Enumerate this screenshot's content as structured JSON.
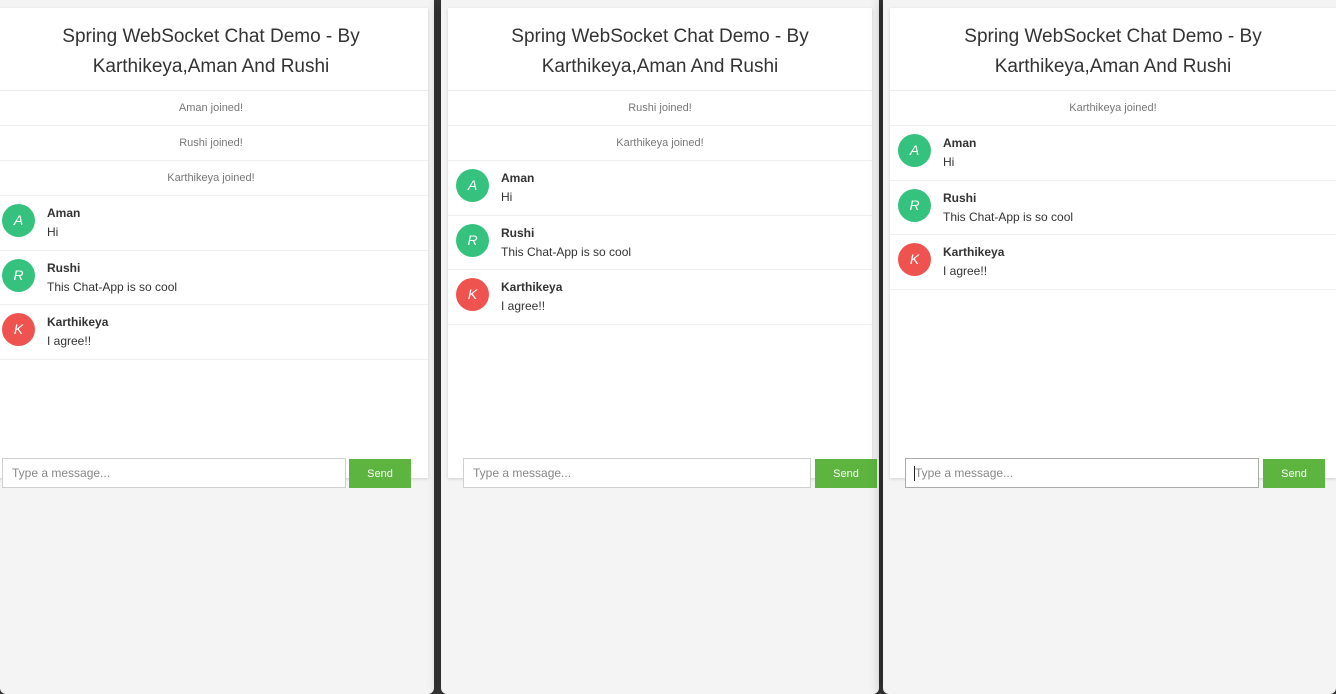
{
  "colors": {
    "green_avatar": "#35c27f",
    "red_avatar": "#ef5350",
    "send_button": "#5db540"
  },
  "windows": [
    {
      "title": "Spring WebSocket Chat Demo - By Karthikeya,Aman And Rushi",
      "events": [
        "Aman joined!",
        "Rushi joined!",
        "Karthikeya joined!"
      ],
      "messages": [
        {
          "avatar": "A",
          "avatar_color": "#35c27f",
          "sender": "Aman",
          "text": "Hi"
        },
        {
          "avatar": "R",
          "avatar_color": "#35c27f",
          "sender": "Rushi",
          "text": "This Chat-App is so cool"
        },
        {
          "avatar": "K",
          "avatar_color": "#ef5350",
          "sender": "Karthikeya",
          "text": "I agree!!"
        }
      ],
      "input_placeholder": "Type a message...",
      "send_label": "Send"
    },
    {
      "title": "Spring WebSocket Chat Demo - By Karthikeya,Aman And Rushi",
      "events": [
        "Rushi joined!",
        "Karthikeya joined!"
      ],
      "messages": [
        {
          "avatar": "A",
          "avatar_color": "#35c27f",
          "sender": "Aman",
          "text": "Hi"
        },
        {
          "avatar": "R",
          "avatar_color": "#35c27f",
          "sender": "Rushi",
          "text": "This Chat-App is so cool"
        },
        {
          "avatar": "K",
          "avatar_color": "#ef5350",
          "sender": "Karthikeya",
          "text": "I agree!!"
        }
      ],
      "input_placeholder": "Type a message...",
      "send_label": "Send"
    },
    {
      "title": "Spring WebSocket Chat Demo - By Karthikeya,Aman And Rushi",
      "events": [
        "Karthikeya joined!"
      ],
      "messages": [
        {
          "avatar": "A",
          "avatar_color": "#35c27f",
          "sender": "Aman",
          "text": "Hi"
        },
        {
          "avatar": "R",
          "avatar_color": "#35c27f",
          "sender": "Rushi",
          "text": "This Chat-App is so cool"
        },
        {
          "avatar": "K",
          "avatar_color": "#ef5350",
          "sender": "Karthikeya",
          "text": "I agree!!"
        }
      ],
      "input_placeholder": "Type a message...",
      "send_label": "Send"
    }
  ]
}
